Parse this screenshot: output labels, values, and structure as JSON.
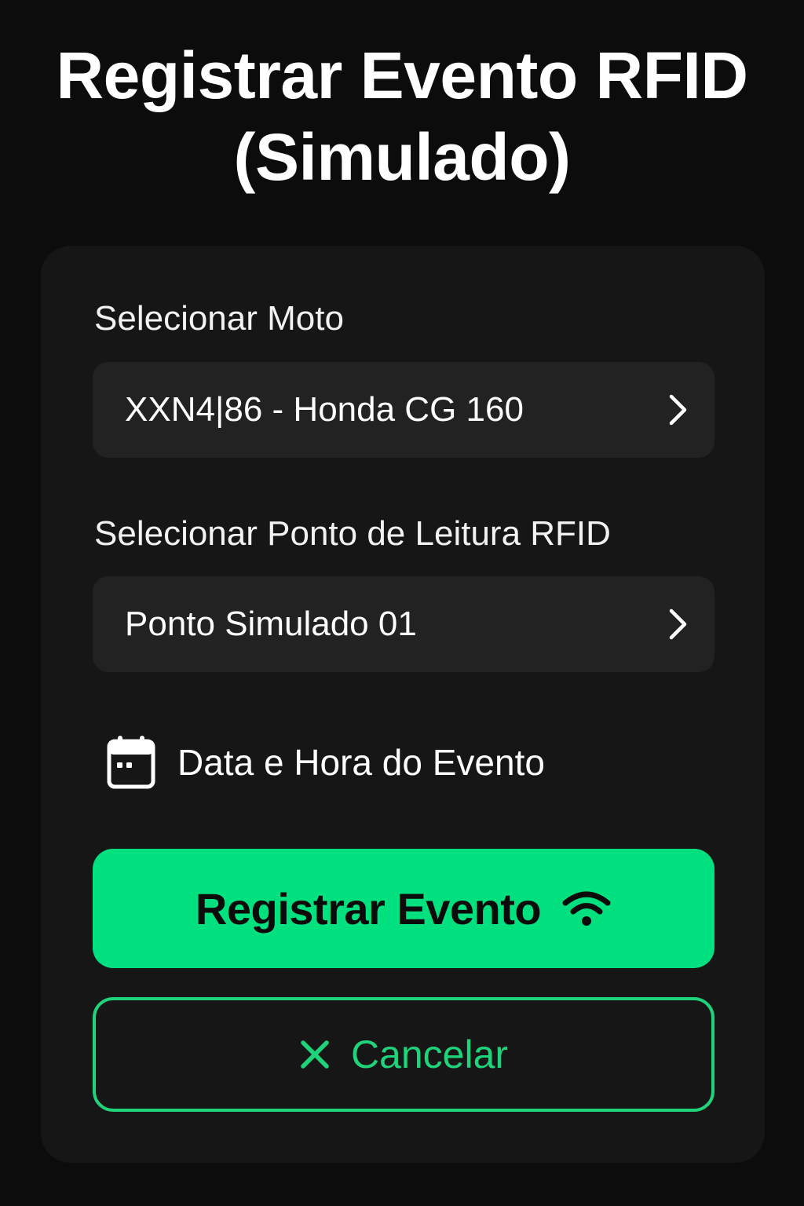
{
  "header": {
    "title_line1": "Registrar Evento RFID",
    "title_line2": "(Simulado)"
  },
  "form": {
    "moto": {
      "label": "Selecionar Moto",
      "value": "XXN4|86 - Honda CG 160",
      "icon": "chevron-right-icon"
    },
    "ponto": {
      "label": "Selecionar Ponto de Leitura RFID",
      "value": "Ponto Simulado 01",
      "icon": "chevron-right-icon"
    },
    "datetime": {
      "label": "Data e Hora do Evento",
      "icon": "calendar-icon"
    }
  },
  "actions": {
    "submit_label": "Registrar Evento",
    "submit_icon": "wifi-icon",
    "cancel_label": "Cancelar",
    "cancel_icon": "close-icon"
  },
  "colors": {
    "background": "#0c0c0c",
    "card": "#161616",
    "field": "#222222",
    "accent": "#00e07f",
    "accent_outline": "#1fd37b",
    "text": "#ffffff"
  }
}
